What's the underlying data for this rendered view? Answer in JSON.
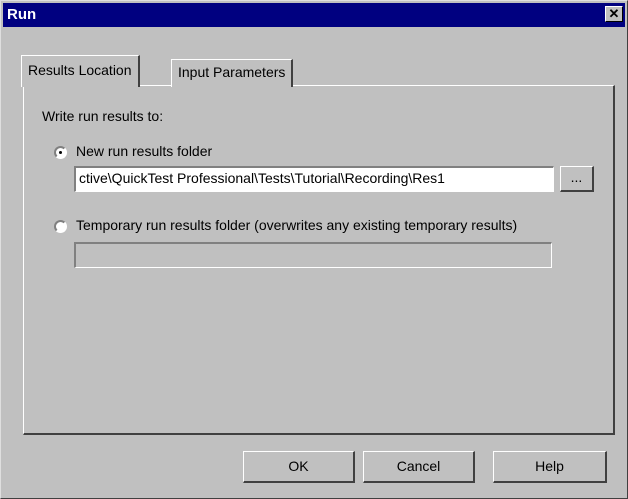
{
  "window": {
    "title": "Run",
    "close_label": "✕"
  },
  "tabs": [
    {
      "label": "Results Location"
    },
    {
      "label": "Input Parameters"
    }
  ],
  "panel": {
    "heading": "Write run results to:",
    "option_new": "New run results folder",
    "path_value": "ctive\\QuickTest Professional\\Tests\\Tutorial\\Recording\\Res1",
    "browse_label": "...",
    "option_temp": "Temporary run results folder (overwrites any existing temporary results)",
    "temp_value": ""
  },
  "buttons": {
    "ok": "OK",
    "cancel": "Cancel",
    "help": "Help"
  }
}
